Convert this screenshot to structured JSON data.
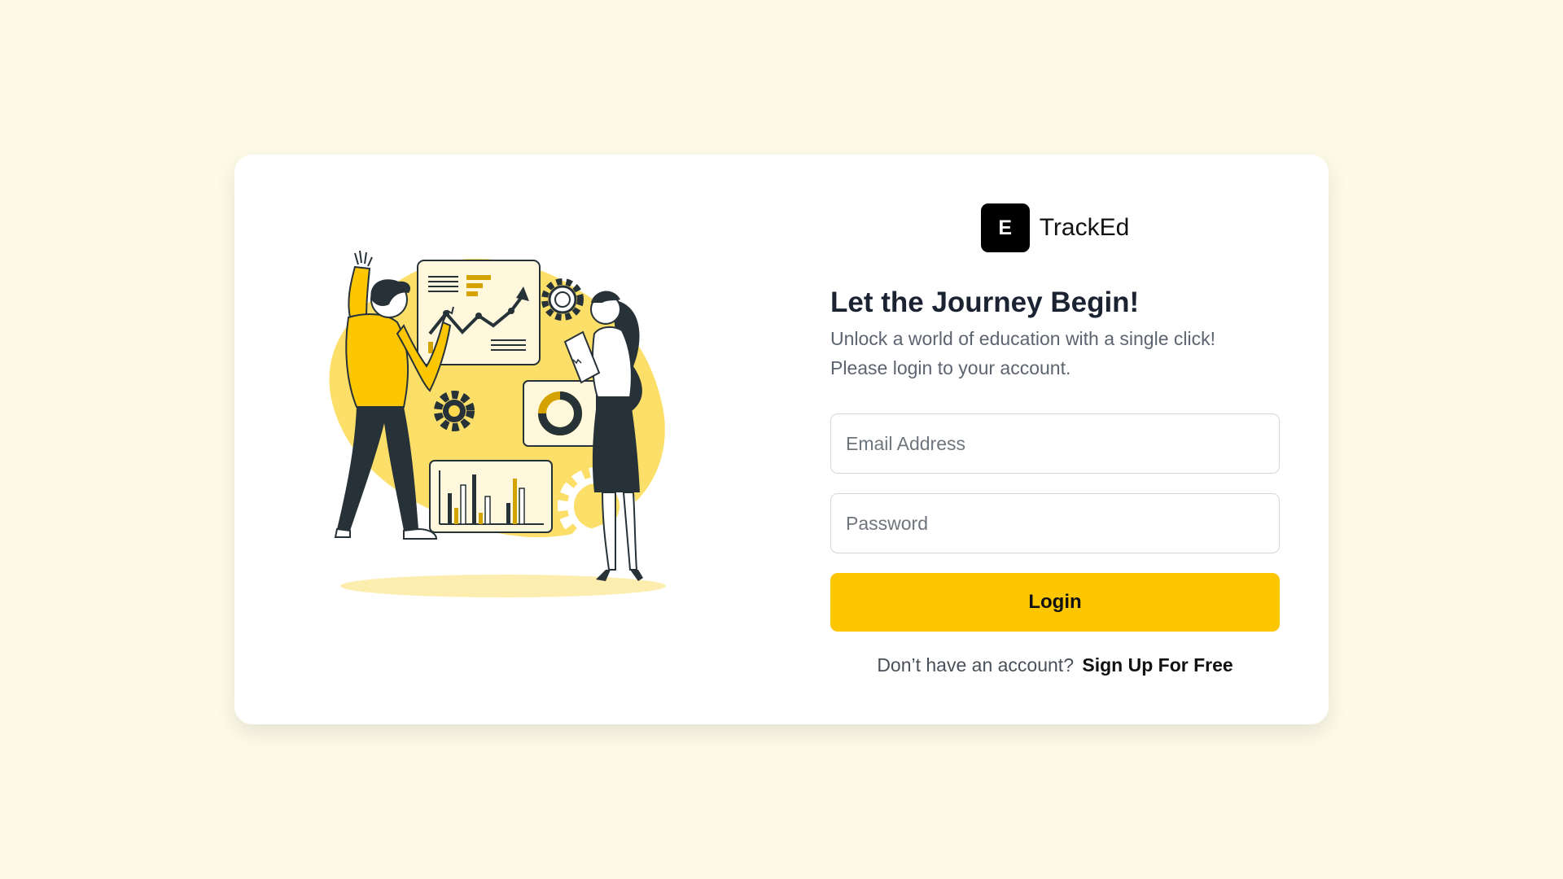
{
  "brand": {
    "logo_letter": "E",
    "name": "TrackEd"
  },
  "heading": {
    "title": "Let the Journey Begin!",
    "subtitle_line1": "Unlock a world of education with a single click!",
    "subtitle_line2": "Please login to your account."
  },
  "form": {
    "email_placeholder": "Email Address",
    "password_placeholder": "Password",
    "login_label": "Login"
  },
  "signup": {
    "prompt": "Don’t have an account?",
    "link_label": "Sign Up For Free"
  },
  "colors": {
    "page_background": "#fefae8",
    "accent": "#fcc600",
    "dark": "#263238"
  }
}
